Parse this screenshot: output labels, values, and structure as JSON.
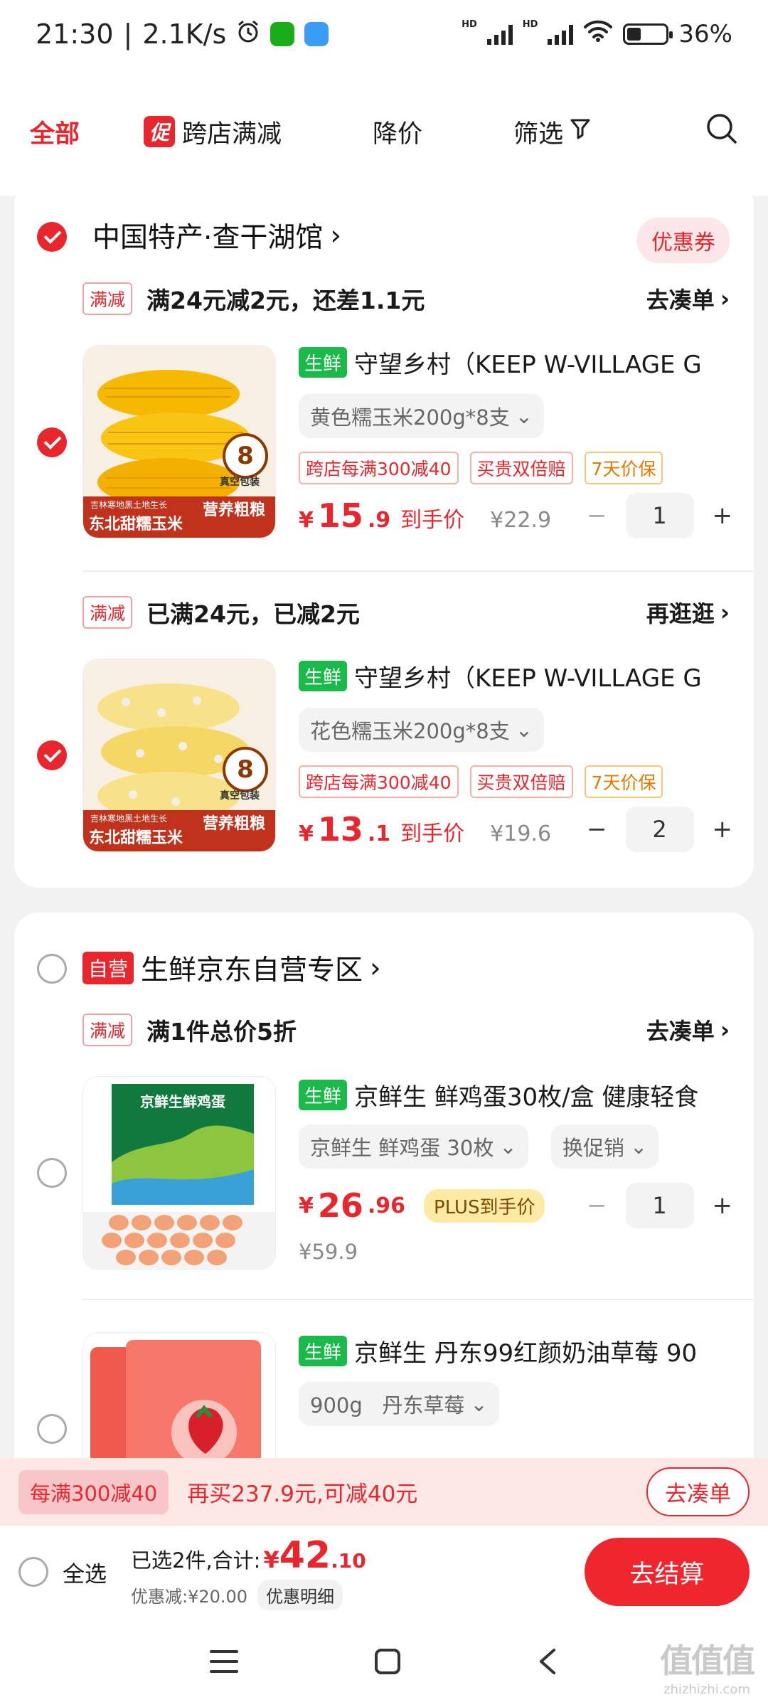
{
  "status": {
    "time": "21:30",
    "speed": "2.1K/s",
    "battery": "36%",
    "battery_level": 0.36,
    "hd1": "HD",
    "hd2": "HD"
  },
  "topnav": {
    "all": "全部",
    "promo_badge": "促",
    "cross_store": "跨店满减",
    "price_drop": "降价",
    "filter": "筛选"
  },
  "store1": {
    "name": "中国特产·查干湖馆",
    "coupon": "优惠券",
    "groups": [
      {
        "promo_tag": "满减",
        "promo_text": "满24元减2元，还差1.1元",
        "promo_link": "去凑单",
        "product": {
          "badge": "生鲜",
          "title": "守望乡村（KEEP W-VILLAGE G",
          "spec": "黄色糯玉米200g*8支",
          "tags": [
            "跨店每满300减40",
            "买贵双倍赔",
            "7天价保"
          ],
          "price_symbol": "¥",
          "price_int": "15",
          "price_dec": ".9",
          "price_label": "到手价",
          "orig_price": "¥22.9",
          "qty": "1",
          "img": {
            "count": "8",
            "count_unit": "支",
            "pack": "真空包装",
            "line1": "吉林寒地黑土地生长",
            "line2": "东北甜糯玉米",
            "line3": "营养粗粮"
          }
        }
      },
      {
        "promo_tag": "满减",
        "promo_text": "已满24元，已减2元",
        "promo_link": "再逛逛",
        "product": {
          "badge": "生鲜",
          "title": "守望乡村（KEEP W-VILLAGE G",
          "spec": "花色糯玉米200g*8支",
          "tags": [
            "跨店每满300减40",
            "买贵双倍赔",
            "7天价保"
          ],
          "price_symbol": "¥",
          "price_int": "13",
          "price_dec": ".1",
          "price_label": "到手价",
          "orig_price": "¥19.6",
          "qty": "2",
          "img": {
            "count": "8",
            "count_unit": "支",
            "pack": "真空包装",
            "line1": "吉林寒地黑土地生长",
            "line2": "东北甜糯玉米",
            "line3": "营养粗粮"
          }
        }
      }
    ]
  },
  "store2": {
    "self_tag": "自营",
    "name": "生鲜京东自营专区",
    "promo_tag": "满减",
    "promo_text": "满1件总价5折",
    "promo_link": "去凑单",
    "products": [
      {
        "badge": "生鲜",
        "title": "京鲜生 鲜鸡蛋30枚/盒 健康轻食",
        "spec": "京鲜生 鲜鸡蛋 30枚",
        "spec2": "换促销",
        "price_symbol": "¥",
        "price_int": "26",
        "price_dec": ".96",
        "plus_label": "PLUS到手价",
        "orig_price": "¥59.9",
        "qty": "1",
        "img_text": "京鲜生鲜鸡蛋"
      },
      {
        "badge": "生鲜",
        "title": "京鲜生 丹东99红颜奶油草莓 90",
        "spec": "900g   丹东草莓"
      }
    ]
  },
  "bottom_promo": {
    "tag": "每满300减40",
    "text": "再买237.9元,可减40元",
    "button": "去凑单"
  },
  "checkout": {
    "select_all": "全选",
    "summary": "已选2件,合计:",
    "currency": "¥",
    "total_int": "42",
    "total_dec": ".10",
    "discount": "优惠减:¥20.00",
    "discount_detail": "优惠明细",
    "pay": "去结算"
  },
  "watermark": {
    "big": "值值值",
    "small": "zhizhizhi.com"
  },
  "colors": {
    "accent": "#e8262e",
    "fresh": "#19b94a",
    "background": "#f2f2f2"
  }
}
